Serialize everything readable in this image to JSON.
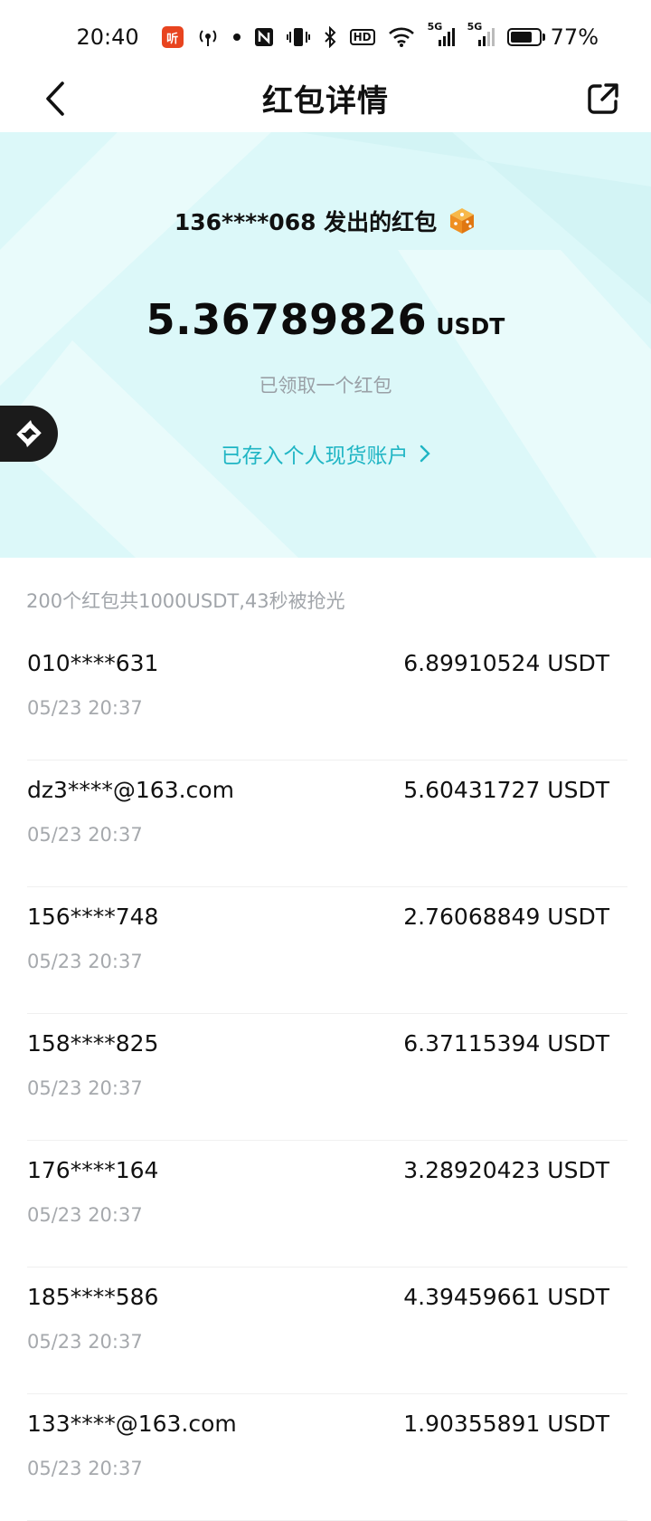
{
  "status_bar": {
    "time": "20:40",
    "listen_badge": "听",
    "hd_label": "HD",
    "network_1": "5G",
    "network_2": "5G",
    "battery_percent": "77%",
    "battery_level": 0.77
  },
  "nav": {
    "title": "红包详情",
    "back_icon": "chevron-left-icon",
    "share_icon": "share-external-icon"
  },
  "hero": {
    "sender_text": "136****068 发出的红包",
    "amount": "5.36789826",
    "unit": "USDT",
    "claimed_text": "已领取一个红包",
    "deposit_link": "已存入个人现货账户"
  },
  "summary": "200个红包共1000USDT,43秒被抢光",
  "records": [
    {
      "name": "010****631",
      "time": "05/23 20:37",
      "amount": "6.89910524 USDT"
    },
    {
      "name": "dz3****@163.com",
      "time": "05/23 20:37",
      "amount": "5.60431727 USDT"
    },
    {
      "name": "156****748",
      "time": "05/23 20:37",
      "amount": "2.76068849 USDT"
    },
    {
      "name": "158****825",
      "time": "05/23 20:37",
      "amount": "6.37115394 USDT"
    },
    {
      "name": "176****164",
      "time": "05/23 20:37",
      "amount": "3.28920423 USDT"
    },
    {
      "name": "185****586",
      "time": "05/23 20:37",
      "amount": "4.39459661 USDT"
    },
    {
      "name": "133****@163.com",
      "time": "05/23 20:37",
      "amount": "1.90355891 USDT"
    }
  ],
  "colors": {
    "hero_bg": "#dcf8f9",
    "accent": "#1fb5c4",
    "muted": "#a1a5aa"
  }
}
